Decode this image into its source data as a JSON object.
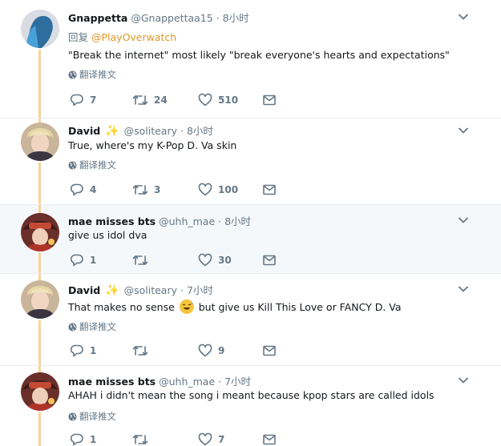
{
  "tweets": [
    {
      "name": "Gnappetta",
      "handle": "@Gnappettaa15",
      "time": "8小时",
      "reply_prefix": "回复",
      "reply_to": "@PlayOverwatch",
      "text": "\"Break the internet\" most likely \"break everyone's hearts and expectations\"",
      "translate": "翻译推文",
      "replies": "7",
      "retweets": "24",
      "likes": "510"
    },
    {
      "name": "David",
      "handle": "@soliteary",
      "time": "8小时",
      "text": "True, where's my K-Pop D. Va skin",
      "translate": "翻译推文",
      "replies": "4",
      "retweets": "3",
      "likes": "100"
    },
    {
      "name": "mae misses bts",
      "handle": "@uhh_mae",
      "time": "8小时",
      "text": "give us idol dva",
      "replies": "1",
      "retweets": "",
      "likes": "30"
    },
    {
      "name": "David",
      "handle": "@soliteary",
      "time": "7小时",
      "text_before": "That makes no sense",
      "text_after": "but give us Kill This Love or FANCY D. Va",
      "translate": "翻译推文",
      "replies": "1",
      "retweets": "",
      "likes": "9"
    },
    {
      "name": "mae misses bts",
      "handle": "@uhh_mae",
      "time": "7小时",
      "text": "AHAH i didn't mean the song i meant because kpop stars are called idols",
      "translate": "翻译推文",
      "replies": "1",
      "retweets": "",
      "likes": "7"
    }
  ],
  "separator": "·",
  "colors": {
    "thread_line": "#f8d39c",
    "mention": "#e0982a",
    "secondary_text": "#657786",
    "highlight_bg": "#f5f8fa"
  }
}
